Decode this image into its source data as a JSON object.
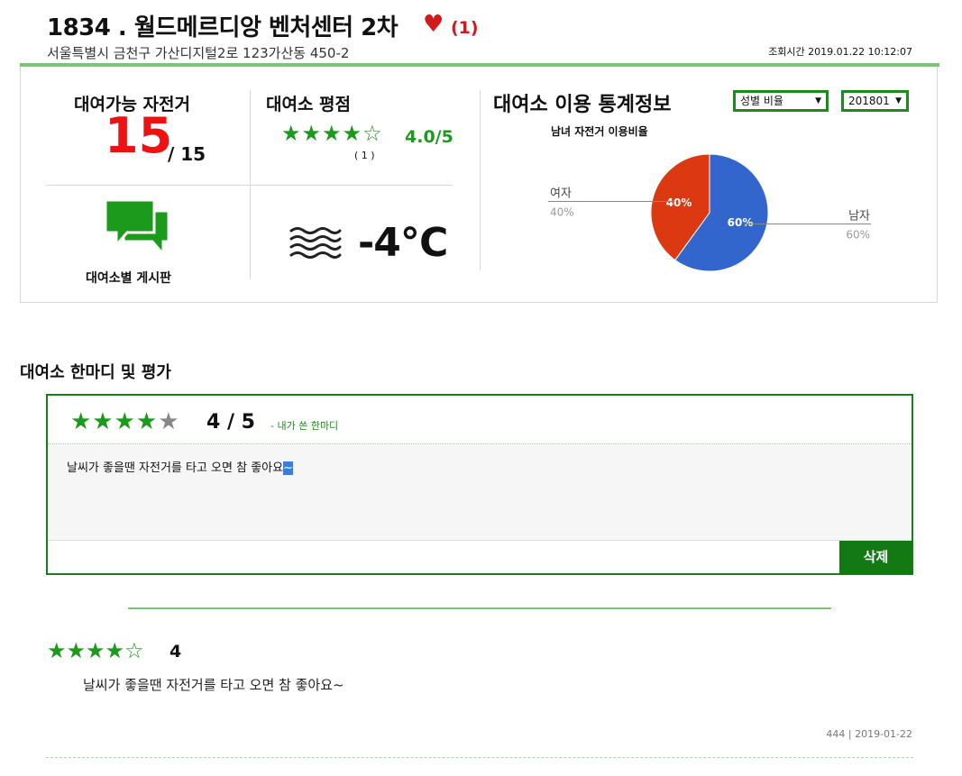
{
  "header": {
    "station_title": "1834 . 월드메르디앙 벤처센터 2차",
    "like_count": "(1)",
    "address": "서울특별시 금천구 가산디지털2로 123가산동 450-2",
    "view_time": "조회시간 2019.01.22 10:12:07"
  },
  "available": {
    "label": "대여가능 자전거",
    "count": "15",
    "total": "/ 15"
  },
  "rating": {
    "label": "대여소 평점",
    "stars": "★★★★☆",
    "score": "4.0/5",
    "review_count": "( 1 )"
  },
  "board": {
    "label": "대여소별 게시판"
  },
  "weather": {
    "temperature": "-4℃"
  },
  "stats": {
    "title": "대여소 이용 통계정보",
    "type_select": "성별 비율",
    "period_select": "201801",
    "chart_title": "남녀 자전거 이용비율"
  },
  "chart_data": {
    "type": "pie",
    "title": "남녀 자전거 이용비율",
    "labels": [
      "남자",
      "여자"
    ],
    "values": [
      60,
      40
    ],
    "value_labels": [
      "60%",
      "40%"
    ],
    "colors": [
      "#3366cc",
      "#dc3912"
    ],
    "legend": "outside-labeled"
  },
  "review_section": {
    "title": "대여소 한마디 및 평가"
  },
  "my_review": {
    "filled_stars": "★★★★",
    "empty_star": "★",
    "score": "4 / 5",
    "note": "- 내가 쓴 한마디",
    "text": "날씨가 좋을땐 자전거를 타고 오면 참 좋아요",
    "selected_text": "~",
    "delete_label": "삭제",
    "star_color": "#1c9a1c",
    "empty_star_color": "#888888"
  },
  "reviews": [
    {
      "stars": "★★★★☆",
      "score": "4",
      "text": "날씨가 좋을땐 자전거를 타고 오면 참 좋아요~",
      "meta": "444 | 2019-01-22"
    }
  ],
  "colors": {
    "accent_green": "#1c9a1c",
    "dark_green": "#137a13",
    "count_red": "#ee1111",
    "heart_red": "#d21a1a"
  }
}
